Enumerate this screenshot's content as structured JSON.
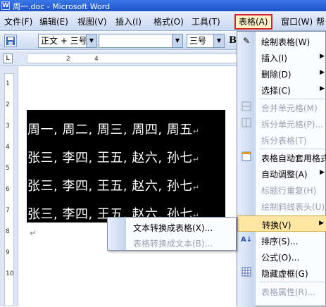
{
  "window": {
    "title": "周一.doc - Microsoft Word"
  },
  "menubar": {
    "items": [
      "文件(F)",
      "编辑(E)",
      "视图(V)",
      "插入(I)",
      "格式(O)",
      "工具(T)",
      "表格(A)",
      "窗口(W)",
      "帮"
    ],
    "active_index": 6
  },
  "toolbar": {
    "style_value": "正文 + 三号",
    "font_value": "",
    "size_value": "三号",
    "bold_label": "B"
  },
  "ruler": {
    "l_marker": "L",
    "top_numbers": [
      "2",
      "4"
    ],
    "left_numbers": [
      "1",
      "2",
      "3",
      "4",
      "5",
      "6",
      "7",
      "8",
      "9",
      "10"
    ]
  },
  "document": {
    "rows": [
      "周一, 周二, 周三, 周四, 周五",
      "张三, 李四, 王五, 赵六, 孙七",
      "张三, 李四, 王五, 赵六, 孙七",
      "张三, 李四, 王五, 赵六, 孙七"
    ],
    "paragraph_mark": "↵"
  },
  "table_menu": {
    "items": [
      {
        "label": "绘制表格(W)",
        "icon": "pencil-icon",
        "enabled": true
      },
      {
        "label": "插入(I)",
        "icon": "",
        "enabled": true,
        "submenu": true
      },
      {
        "label": "删除(D)",
        "icon": "",
        "enabled": true,
        "submenu": true
      },
      {
        "label": "选择(C)",
        "icon": "",
        "enabled": true,
        "submenu": true
      },
      {
        "label": "合并单元格(M)",
        "icon": "merge-cells-icon",
        "enabled": false
      },
      {
        "label": "拆分单元格(P)...",
        "icon": "split-cells-icon",
        "enabled": false
      },
      {
        "label": "拆分表格(T)",
        "icon": "",
        "enabled": false
      },
      {
        "label": "表格自动套用格式",
        "icon": "autoformat-icon",
        "enabled": true
      },
      {
        "label": "自动调整(A)",
        "icon": "",
        "enabled": true,
        "submenu": true
      },
      {
        "label": "标题行重复(H)",
        "icon": "",
        "enabled": false
      },
      {
        "label": "绘制斜线表头(U)",
        "icon": "",
        "enabled": false
      },
      {
        "label": "转换(V)",
        "icon": "",
        "enabled": true,
        "submenu": true,
        "highlight": true
      },
      {
        "label": "排序(S)...",
        "icon": "sort-icon",
        "enabled": true
      },
      {
        "label": "公式(O)...",
        "icon": "",
        "enabled": true
      },
      {
        "label": "隐藏虚框(G)",
        "icon": "grid-icon",
        "enabled": true
      },
      {
        "label": "表格属性(R)...",
        "icon": "",
        "enabled": false
      }
    ]
  },
  "submenu": {
    "items": [
      {
        "label": "文本转换成表格(X)...",
        "enabled": true
      },
      {
        "label": "表格转换成文本(B)...",
        "enabled": false
      }
    ]
  },
  "colors": {
    "menu_highlight": "#ffe7a2",
    "active_outline": "#d9232a",
    "selection": "#000000"
  }
}
